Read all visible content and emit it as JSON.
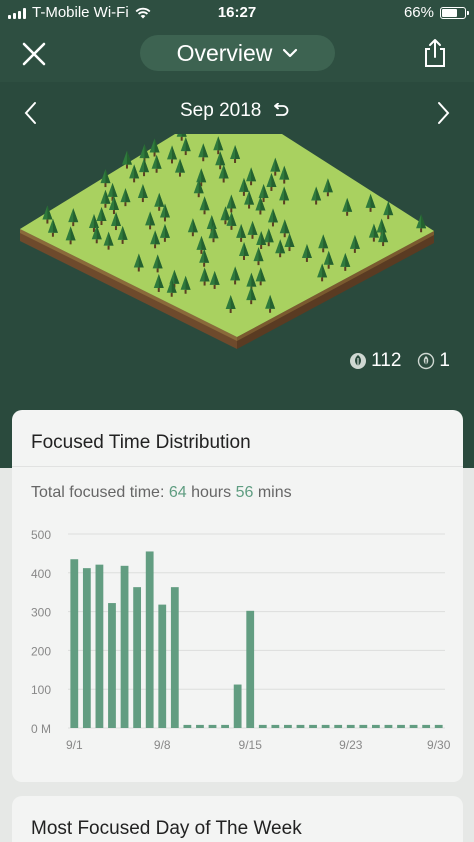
{
  "status_bar": {
    "carrier": "T-Mobile Wi-Fi",
    "time": "16:27",
    "battery": "66%",
    "battery_level": 0.66
  },
  "header": {
    "title": "Overview",
    "close_icon": "close-icon",
    "dropdown_icon": "chevron-down-icon",
    "share_icon": "share-icon"
  },
  "forest_view": {
    "month": "Sep 2018",
    "prev_icon": "chevron-left-icon",
    "next_icon": "chevron-right-icon",
    "reset_icon": "undo-icon",
    "healthy_trees": "112",
    "dead_trees": "1"
  },
  "focused_time": {
    "title": "Focused Time Distribution",
    "total_label": "Total focused time:",
    "hours": "64",
    "hours_unit": "hours",
    "mins": "56",
    "mins_unit": "mins"
  },
  "chart_data": {
    "type": "bar",
    "categories": [
      "9/1",
      "9/2",
      "9/3",
      "9/4",
      "9/5",
      "9/6",
      "9/7",
      "9/8",
      "9/9",
      "9/10",
      "9/11",
      "9/12",
      "9/13",
      "9/14",
      "9/15",
      "9/16",
      "9/17",
      "9/18",
      "9/19",
      "9/20",
      "9/21",
      "9/22",
      "9/23",
      "9/24",
      "9/25",
      "9/26",
      "9/27",
      "9/28",
      "9/29",
      "9/30"
    ],
    "values": [
      435,
      412,
      421,
      322,
      418,
      363,
      455,
      318,
      363,
      8,
      8,
      8,
      8,
      112,
      302,
      8,
      8,
      8,
      8,
      8,
      8,
      8,
      8,
      8,
      8,
      8,
      8,
      8,
      8,
      8
    ],
    "x_tick_labels": [
      "9/1",
      "9/8",
      "9/15",
      "9/23",
      "9/30"
    ],
    "y_ticks": [
      0,
      100,
      200,
      300,
      400,
      500
    ],
    "y_tick_labels": [
      "0 M",
      "100",
      "200",
      "300",
      "400",
      "500"
    ],
    "ylim": [
      0,
      500
    ],
    "bar_color": "#629d81",
    "grid": true
  },
  "next_card": {
    "title": "Most Focused Day of The Week"
  }
}
